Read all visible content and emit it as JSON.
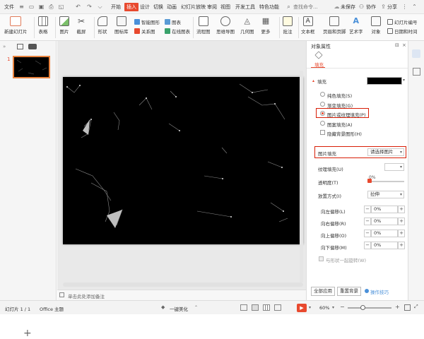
{
  "menu": {
    "file": "文件",
    "tabs": [
      "开始",
      "插入",
      "设计",
      "切换",
      "动画",
      "幻灯片放映",
      "审阅",
      "视图",
      "开发工具",
      "特色功能"
    ],
    "active_tab": "插入",
    "search": "查找命令...",
    "unsaved": "未保存",
    "collab": "协作",
    "share": "分享"
  },
  "ribbon": {
    "new_slide": "新建幻灯片",
    "table": "表格",
    "picture": "图片",
    "screenshot": "截屏",
    "shape": "形状",
    "icon_lib": "图标库",
    "smart_graphic": "智能图形",
    "relation_graph": "关系图",
    "chart": "图表",
    "online_chart": "在线图表",
    "flowchart": "流程图",
    "mindmap": "思维导图",
    "geometry": "几何图",
    "more": "更多",
    "comment": "批注",
    "textbox": "文本框",
    "header_footer": "页眉和页脚",
    "wordart": "艺术字",
    "object": "对象",
    "slide_number": "幻灯片编号",
    "datetime": "日期和时间"
  },
  "slides": {
    "thumb_number": "1"
  },
  "notes": {
    "placeholder": "单击此处添加备注"
  },
  "pane": {
    "title": "对象属性",
    "tab_fill": "填充",
    "section_fill": "填充",
    "fill_options": [
      "纯色填充(S)",
      "渐变填充(G)",
      "图片或纹理填充(P)",
      "图案填充(A)"
    ],
    "selected_option": "图片或纹理填充(P)",
    "hide_bg": "隐藏背景图形(H)",
    "picture_fill_label": "图片填充",
    "picture_fill_value": "请选择图片",
    "texture_fill_label": "纹理填充(U)",
    "transparency_label": "透明度(T)",
    "transparency_value": "0%",
    "transparency_pct": 0,
    "placement_label": "放置方式(I)",
    "placement_value": "拉伸",
    "offsets": [
      {
        "label": "向左偏移(L)",
        "value": "0%"
      },
      {
        "label": "向右偏移(R)",
        "value": "0%"
      },
      {
        "label": "向上偏移(O)",
        "value": "0%"
      },
      {
        "label": "向下偏移(M)",
        "value": "0%"
      }
    ],
    "rotate_with_shape": "与形状一起旋转(W)",
    "apply_all": "全部应用",
    "reset_bg": "重置背景",
    "tips": "操作技巧"
  },
  "status": {
    "slide_info": "幻灯片 1 / 1",
    "theme": "Office 主题",
    "beautify": "一键美化",
    "zoom": "60%"
  },
  "colors": {
    "accent": "#e8492e",
    "highlight_box": "#d81e06",
    "fill_swatch": "#000000"
  }
}
